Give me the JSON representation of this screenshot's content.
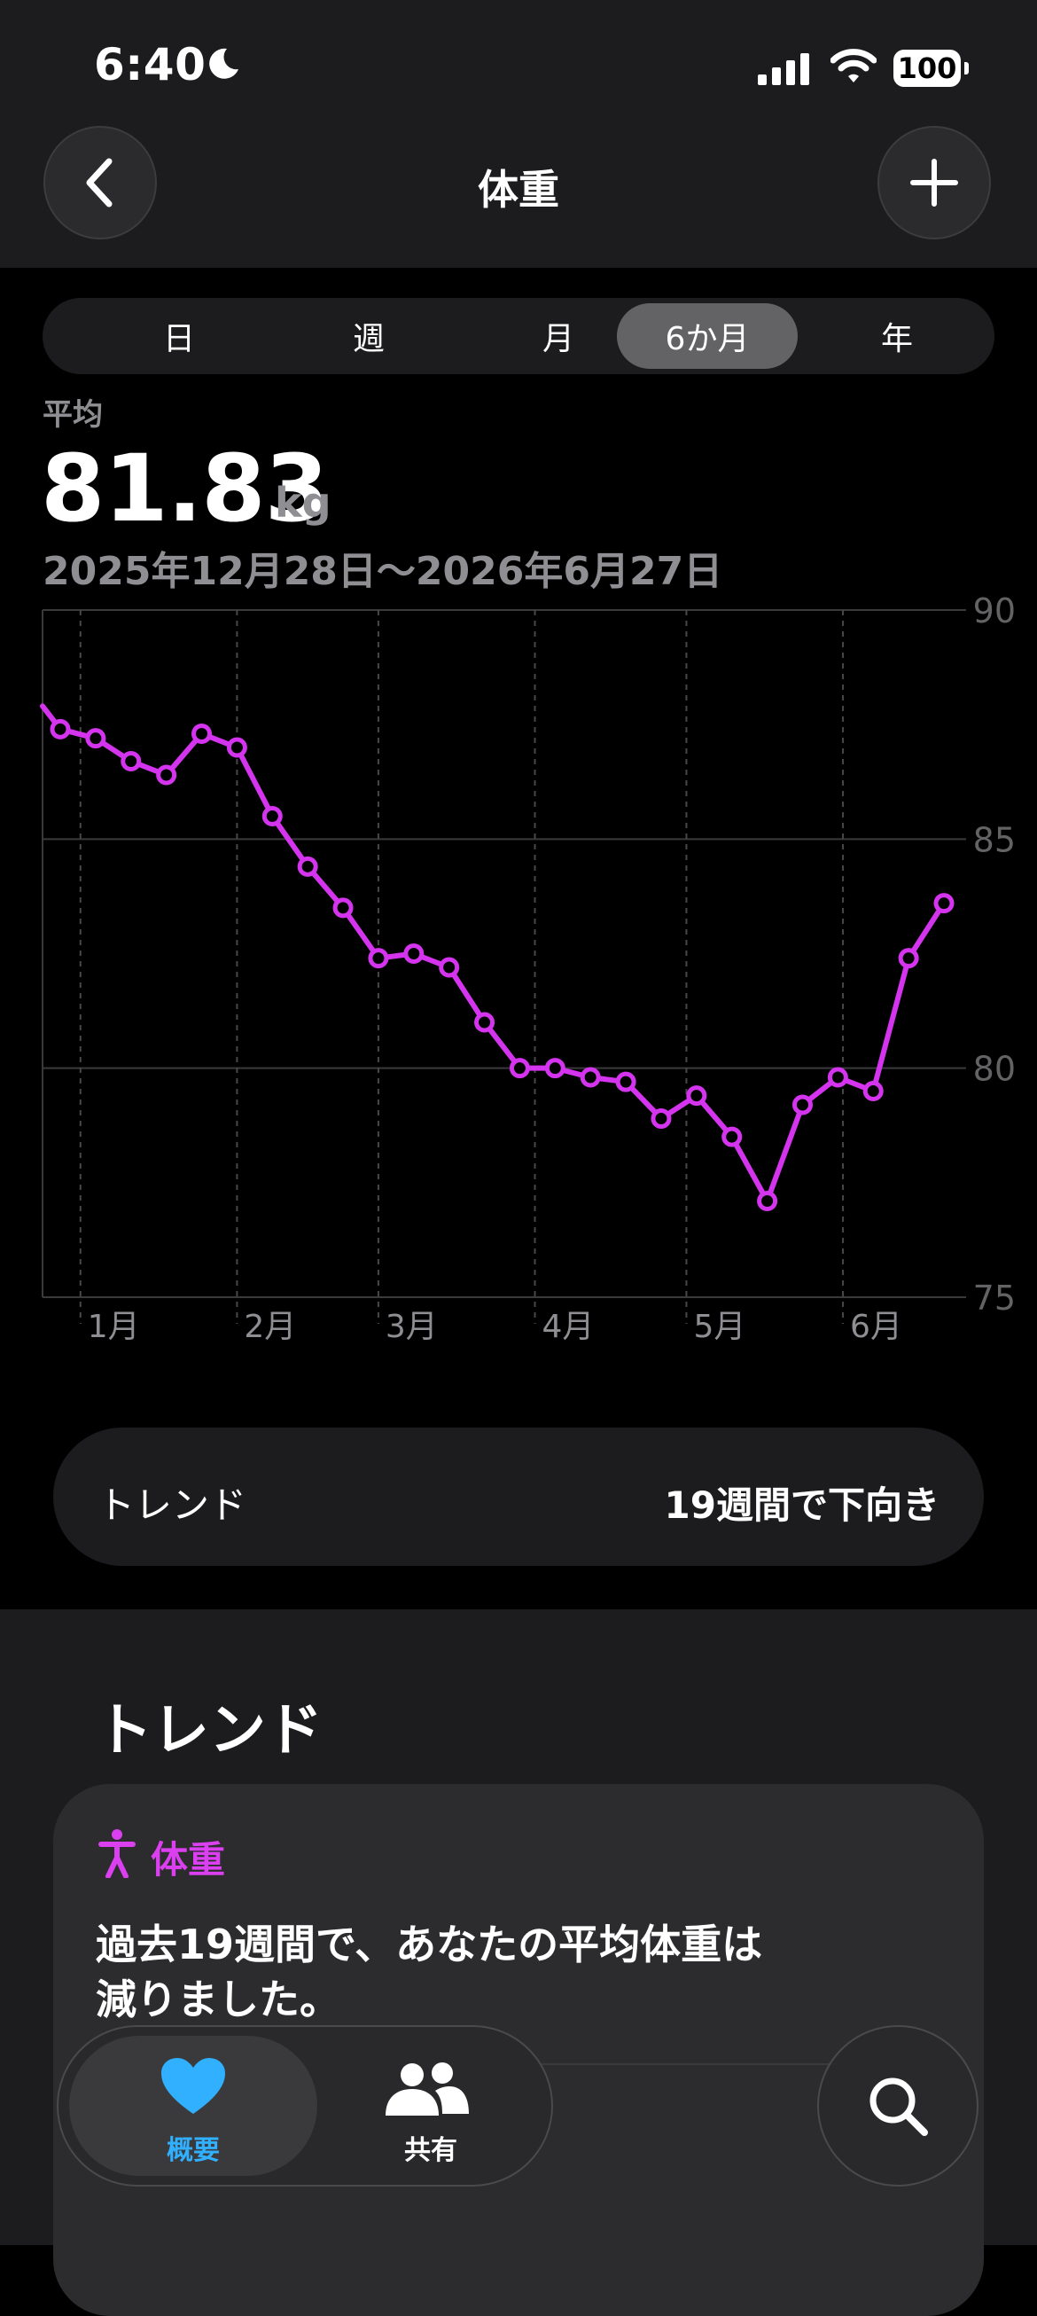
{
  "status_bar": {
    "time": "6:40",
    "battery": "100"
  },
  "nav": {
    "title": "体重"
  },
  "segments": [
    {
      "label": "日",
      "selected": false
    },
    {
      "label": "週",
      "selected": false
    },
    {
      "label": "月",
      "selected": false
    },
    {
      "label": "6か月",
      "selected": true
    },
    {
      "label": "年",
      "selected": false
    }
  ],
  "summary": {
    "label": "平均",
    "value": "81.83",
    "unit": "kg",
    "date_range": "2025年12月28日〜2026年6月27日"
  },
  "chart_data": {
    "type": "line",
    "ylim": [
      75,
      90
    ],
    "y_ticks": [
      "90",
      "85",
      "80",
      "75"
    ],
    "x_tick_labels": [
      "1月",
      "2月",
      "3月",
      "4月",
      "5月",
      "6月"
    ],
    "grid": true,
    "line_color": "#d534ef",
    "x": [
      "2025-12-28",
      "2026-01-04",
      "2026-01-11",
      "2026-01-18",
      "2026-01-25",
      "2026-02-01",
      "2026-02-08",
      "2026-02-15",
      "2026-02-22",
      "2026-03-01",
      "2026-03-08",
      "2026-03-15",
      "2026-03-22",
      "2026-03-29",
      "2026-04-05",
      "2026-04-12",
      "2026-04-19",
      "2026-04-26",
      "2026-05-03",
      "2026-05-10",
      "2026-05-17",
      "2026-05-24",
      "2026-05-31",
      "2026-06-07",
      "2026-06-14",
      "2026-06-21"
    ],
    "values": [
      87.4,
      87.2,
      86.7,
      86.4,
      87.3,
      87.0,
      85.5,
      84.4,
      83.5,
      82.4,
      82.5,
      82.2,
      81.0,
      80.0,
      80.0,
      79.8,
      79.7,
      78.9,
      79.4,
      78.5,
      77.1,
      79.2,
      79.8,
      79.5,
      82.4,
      83.6
    ]
  },
  "trend_row": {
    "label": "トレンド",
    "value": "19週間で下向き"
  },
  "trends_section": {
    "title": "トレンド",
    "card_metric": "体重",
    "card_text_line1": "過去19週間で、あなたの平均体重は",
    "card_text_line2": "減りました。"
  },
  "tabbar": {
    "summary_label": "概要",
    "sharing_label": "共有",
    "accent": "#30b0ff"
  },
  "icons": [
    "moon-icon",
    "signal-icon",
    "wifi-icon",
    "chevron-left-icon",
    "plus-icon",
    "figure-icon",
    "heart-icon",
    "people-icon",
    "search-icon"
  ]
}
